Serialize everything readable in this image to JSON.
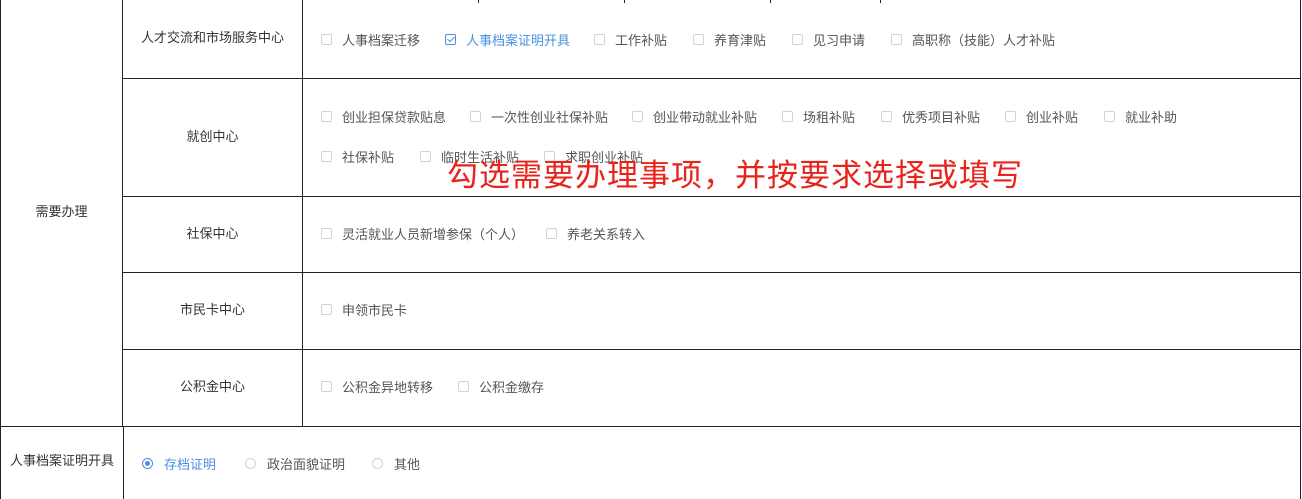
{
  "section_label": "需要办理",
  "rows": [
    {
      "center": "人才交流和市场服务中心",
      "options": [
        {
          "label": "人事档案迁移",
          "checked": false
        },
        {
          "label": "人事档案证明开具",
          "checked": true
        },
        {
          "label": "工作补贴",
          "checked": false
        },
        {
          "label": "养育津贴",
          "checked": false
        },
        {
          "label": "见习申请",
          "checked": false
        },
        {
          "label": "高职称（技能）人才补贴",
          "checked": false
        }
      ]
    },
    {
      "center": "就创中心",
      "options": [
        {
          "label": "创业担保贷款贴息",
          "checked": false
        },
        {
          "label": "一次性创业社保补贴",
          "checked": false
        },
        {
          "label": "创业带动就业补贴",
          "checked": false
        },
        {
          "label": "场租补贴",
          "checked": false
        },
        {
          "label": "优秀项目补贴",
          "checked": false
        },
        {
          "label": "创业补贴",
          "checked": false
        },
        {
          "label": "就业补助",
          "checked": false
        },
        {
          "label": "社保补贴",
          "checked": false
        },
        {
          "label": "临时生活补贴",
          "checked": false
        },
        {
          "label": "求职创业补贴",
          "checked": false
        }
      ]
    },
    {
      "center": "社保中心",
      "options": [
        {
          "label": "灵活就业人员新增参保（个人）",
          "checked": false
        },
        {
          "label": "养老关系转入",
          "checked": false
        }
      ]
    },
    {
      "center": "市民卡中心",
      "options": [
        {
          "label": "申领市民卡",
          "checked": false
        }
      ]
    },
    {
      "center": "公积金中心",
      "options": [
        {
          "label": "公积金异地转移",
          "checked": false
        },
        {
          "label": "公积金缴存",
          "checked": false
        }
      ]
    }
  ],
  "proof_row": {
    "label": "人事档案证明开具",
    "options": [
      {
        "label": "存档证明",
        "selected": true
      },
      {
        "label": "政治面貌证明",
        "selected": false
      },
      {
        "label": "其他",
        "selected": false
      }
    ]
  },
  "overlay_text": "勾选需要办理事项，并按要求选择或填写",
  "colors": {
    "accent": "#4a90e2",
    "overlay": "#e8231a",
    "border": "#222222"
  }
}
